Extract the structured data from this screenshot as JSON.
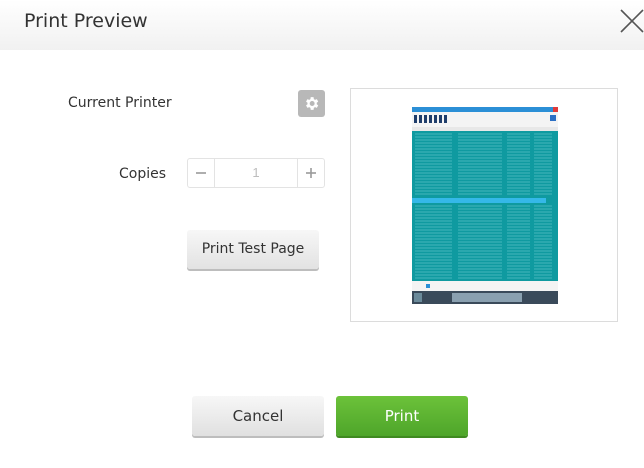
{
  "dialog": {
    "title": "Print Preview",
    "close_icon": "close-icon"
  },
  "printer": {
    "label": "Current Printer",
    "settings_icon": "gear-icon"
  },
  "copies": {
    "label": "Copies",
    "value": "1",
    "minus_icon": "minus-icon",
    "plus_icon": "plus-icon"
  },
  "test_page": {
    "label": "Print Test Page"
  },
  "actions": {
    "cancel_label": "Cancel",
    "print_label": "Print"
  },
  "colors": {
    "print_button": "#5cb531",
    "preview_teal": "#0f9aa0",
    "highlight_row": "#35b8e8"
  }
}
